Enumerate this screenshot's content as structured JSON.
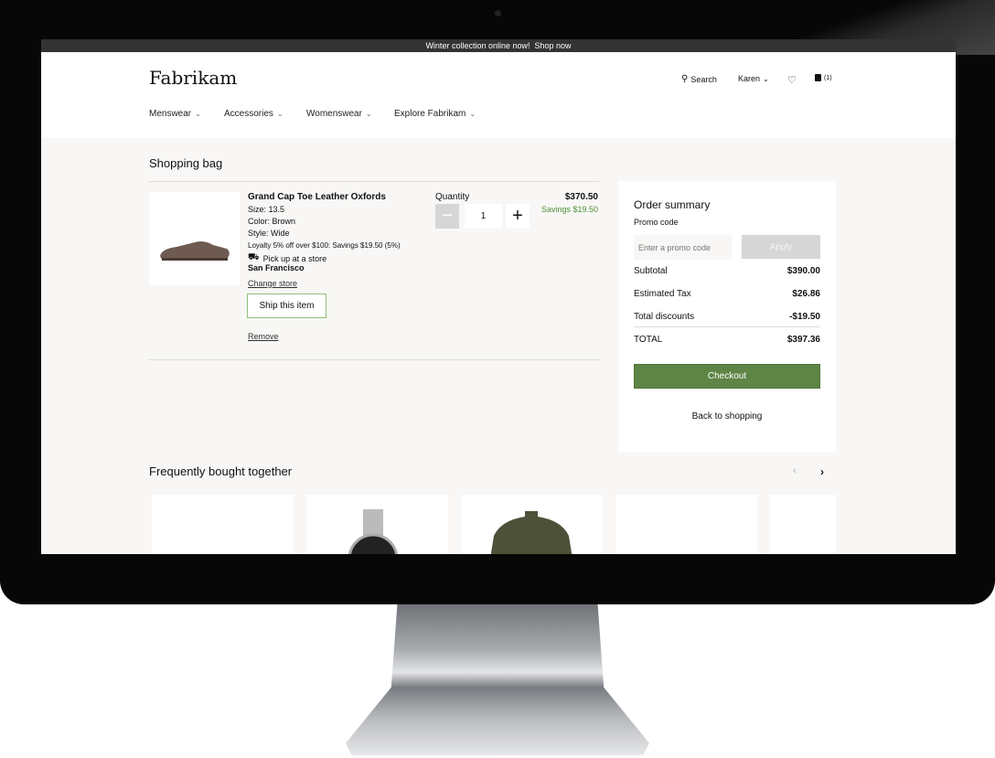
{
  "banner": {
    "text": "Winter collection online now!",
    "link": "Shop now"
  },
  "header": {
    "logo": "Fabrikam",
    "search": "Search",
    "user": "Karen",
    "cart_count": "(1)",
    "nav": [
      {
        "label": "Menswear"
      },
      {
        "label": "Accessories"
      },
      {
        "label": "Womenswear"
      },
      {
        "label": "Explore Fabrikam"
      }
    ]
  },
  "bag": {
    "title": "Shopping bag",
    "item": {
      "name": "Grand Cap Toe Leather Oxfords",
      "size": "Size: 13.5",
      "color": "Color: Brown",
      "style": "Style: Wide",
      "loyalty": "Loyalty 5% off over $100: Savings $19.50 (5%)",
      "pickup": "Pick up at a store",
      "store": "San Francisco",
      "change_store": "Change store",
      "ship": "Ship this item",
      "remove": "Remove",
      "quantity_label": "Quantity",
      "quantity": "1",
      "price": "$370.50",
      "savings": "Savings $19.50"
    }
  },
  "summary": {
    "title": "Order summary",
    "promo_label": "Promo code",
    "promo_placeholder": "Enter a promo code",
    "apply": "Apply",
    "subtotal_label": "Subtotal",
    "subtotal": "$390.00",
    "tax_label": "Estimated Tax",
    "tax": "$26.86",
    "discounts_label": "Total discounts",
    "discounts": "-$19.50",
    "total_label": "TOTAL",
    "total": "$397.36",
    "checkout": "Checkout",
    "back": "Back to shopping"
  },
  "recommend": {
    "title": "Frequently bought together"
  },
  "colors": {
    "accent": "#5e8545",
    "savings": "#4f8f3a",
    "promo_bar": "#333333",
    "page_bg": "#f8f7f5"
  }
}
